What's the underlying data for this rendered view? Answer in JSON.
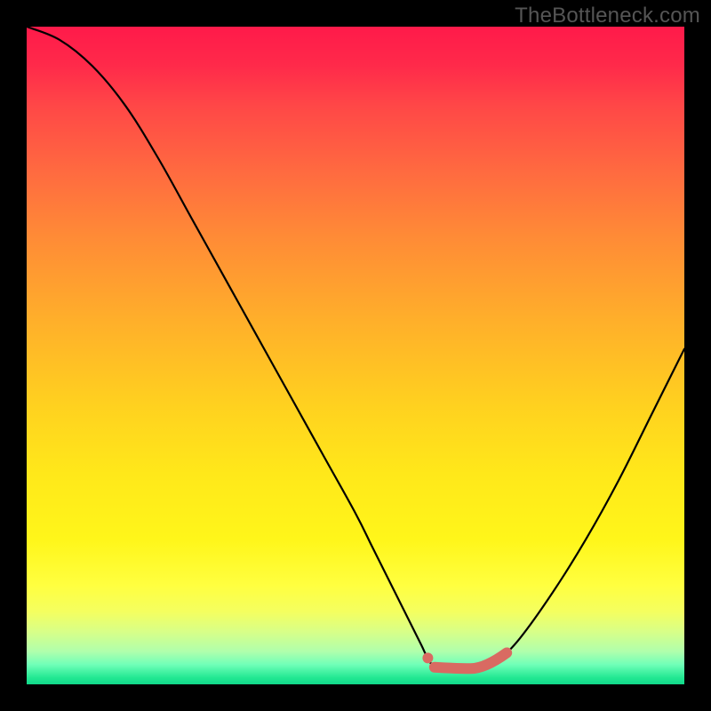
{
  "watermark": "TheBottleneck.com",
  "chart_data": {
    "type": "line",
    "title": "",
    "xlabel": "",
    "ylabel": "",
    "xlim": [
      0,
      100
    ],
    "ylim": [
      0,
      100
    ],
    "series": [
      {
        "name": "curve",
        "x": [
          0,
          5,
          10,
          15,
          20,
          25,
          30,
          35,
          40,
          45,
          50,
          52.5,
          55,
          57.5,
          60,
          61,
          62.5,
          67.5,
          70,
          72,
          75,
          80,
          85,
          90,
          95,
          100
        ],
        "values": [
          100,
          98,
          94,
          88,
          80,
          71,
          62,
          53,
          44,
          35,
          26,
          21,
          16,
          11,
          6,
          4,
          2.5,
          2.5,
          3,
          4,
          7,
          14,
          22,
          31,
          41,
          51
        ]
      }
    ],
    "markers": [
      {
        "x": 61.0,
        "y": 4.0,
        "style": "dot",
        "color": "#d96a62"
      },
      {
        "x": 62.0,
        "y": 2.6,
        "style": "bar-start",
        "color": "#d96a62"
      },
      {
        "x": 73.0,
        "y": 4.8,
        "style": "bar-end",
        "color": "#d96a62"
      }
    ],
    "gradient_stops": [
      {
        "pos": 0.0,
        "color": "#ff1a4a"
      },
      {
        "pos": 0.5,
        "color": "#ffd21f"
      },
      {
        "pos": 0.85,
        "color": "#ffff40"
      },
      {
        "pos": 1.0,
        "color": "#11d88a"
      }
    ]
  }
}
